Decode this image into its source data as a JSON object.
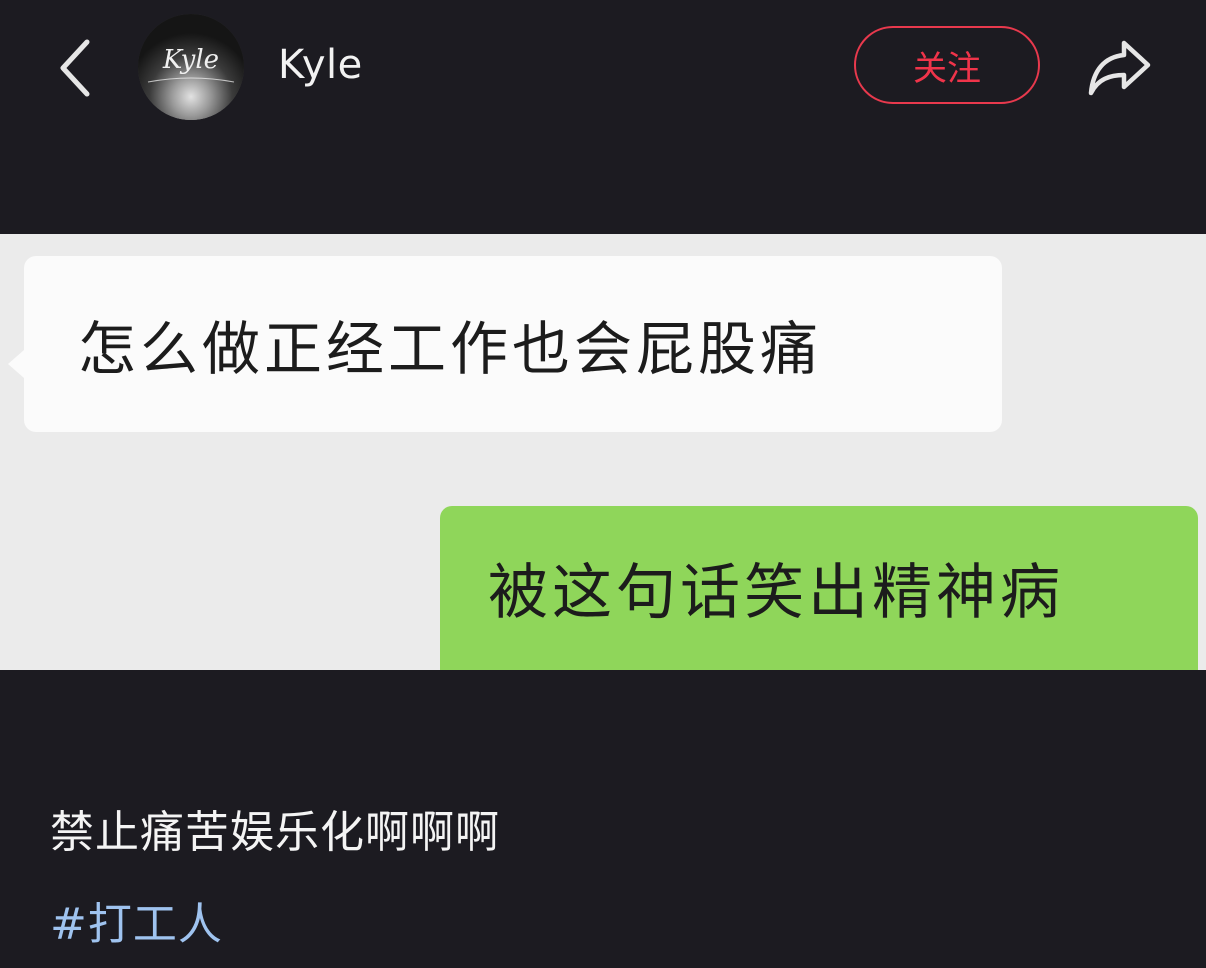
{
  "header": {
    "back_icon": "chevron-left-icon",
    "avatar_text": "Kyle",
    "username": "Kyle",
    "follow_label": "关注",
    "share_icon": "share-arrow-icon"
  },
  "post": {
    "image": {
      "incoming_message": "怎么做正经工作也会屁股痛",
      "outgoing_message": "被这句话笑出精神病"
    },
    "caption": "禁止痛苦娱乐化啊啊啊",
    "hashtag": "#打工人"
  },
  "colors": {
    "background": "#1c1b21",
    "follow_accent": "#f0344a",
    "hashtag": "#9fc3ef",
    "bubble_outgoing": "#8fd65a",
    "bubble_incoming": "#fbfbfb"
  }
}
